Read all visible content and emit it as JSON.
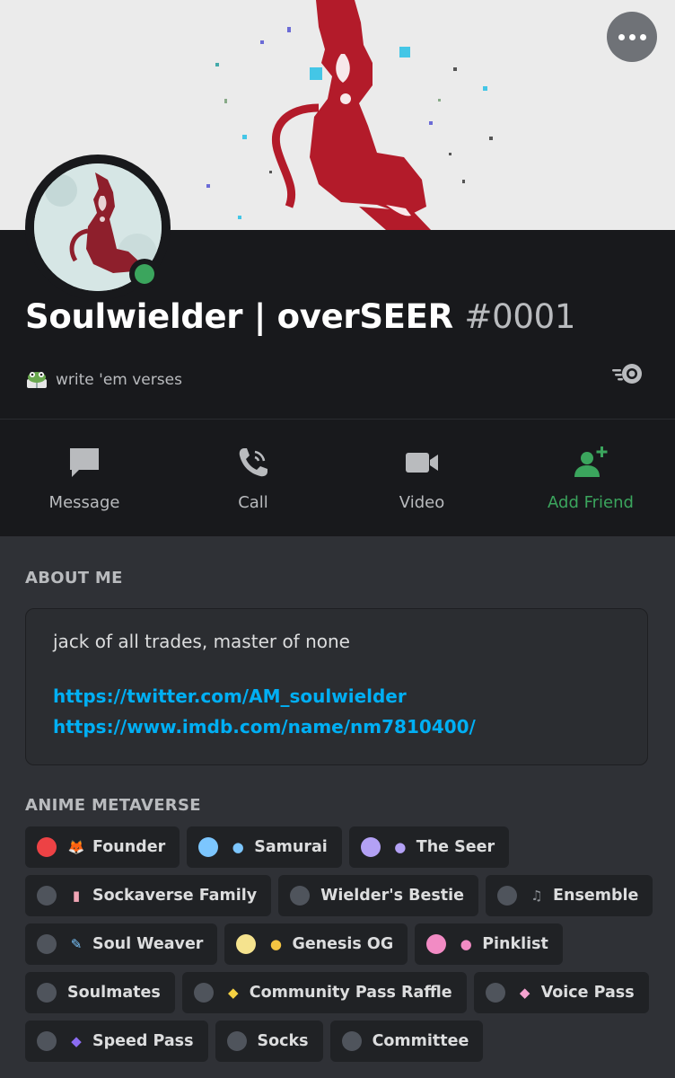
{
  "profile": {
    "username": "Soulwielder | overSEER",
    "discriminator": "#0001",
    "status": "online",
    "custom_status_icon": "frog-reading-emoji",
    "custom_status": "write 'em verses",
    "badge_icon": "nitro-boost-icon"
  },
  "actions": [
    {
      "label": "Message",
      "icon": "message-icon"
    },
    {
      "label": "Call",
      "icon": "phone-icon"
    },
    {
      "label": "Video",
      "icon": "video-camera-icon"
    },
    {
      "label": "Add Friend",
      "icon": "add-friend-icon"
    }
  ],
  "about": {
    "heading": "ABOUT ME",
    "text": "jack of all trades, master of none",
    "links": [
      "https://twitter.com/AM_soulwielder",
      "https://www.imdb.com/name/nm7810400/"
    ]
  },
  "server": {
    "heading": "ANIME METAVERSE",
    "roles": [
      [
        {
          "name": "Founder",
          "color": "#ed4245",
          "emoji": "kitsune-mask"
        },
        {
          "name": "Samurai",
          "color": "#7cc6fe",
          "emoji": "cat-face"
        },
        {
          "name": "The Seer",
          "color": "#b3a1f5",
          "emoji": "purple-cat"
        }
      ],
      [
        {
          "name": "Sockaverse Family",
          "color": "#4f545c",
          "emoji": "socks"
        },
        {
          "name": "Wielder's Bestie",
          "color": "#4f545c",
          "emoji": ""
        },
        {
          "name": "Ensemble",
          "color": "#4f545c",
          "emoji": "music-notes"
        }
      ],
      [
        {
          "name": "Soul Weaver",
          "color": "#4f545c",
          "emoji": "pen"
        },
        {
          "name": "Genesis OG",
          "color": "#f5e38e",
          "emoji": "chick"
        },
        {
          "name": "Pinklist",
          "color": "#f28bc4",
          "emoji": "pink-bunny"
        }
      ],
      [
        {
          "name": "Soulmates",
          "color": "#4f545c",
          "emoji": ""
        },
        {
          "name": "Community Pass Raffle",
          "color": "#4f545c",
          "emoji": "yellow-diamond"
        },
        {
          "name": "Voice Pass",
          "color": "#4f545c",
          "emoji": "pink-diamond"
        }
      ],
      [
        {
          "name": "Speed Pass",
          "color": "#4f545c",
          "emoji": "purple-diamond"
        },
        {
          "name": "Socks",
          "color": "#4f545c",
          "emoji": ""
        },
        {
          "name": "Committee",
          "color": "#4f545c",
          "emoji": ""
        }
      ]
    ]
  },
  "colors": {
    "accent_green": "#3ba55d",
    "link": "#00aff4",
    "background": "#2f3136"
  }
}
